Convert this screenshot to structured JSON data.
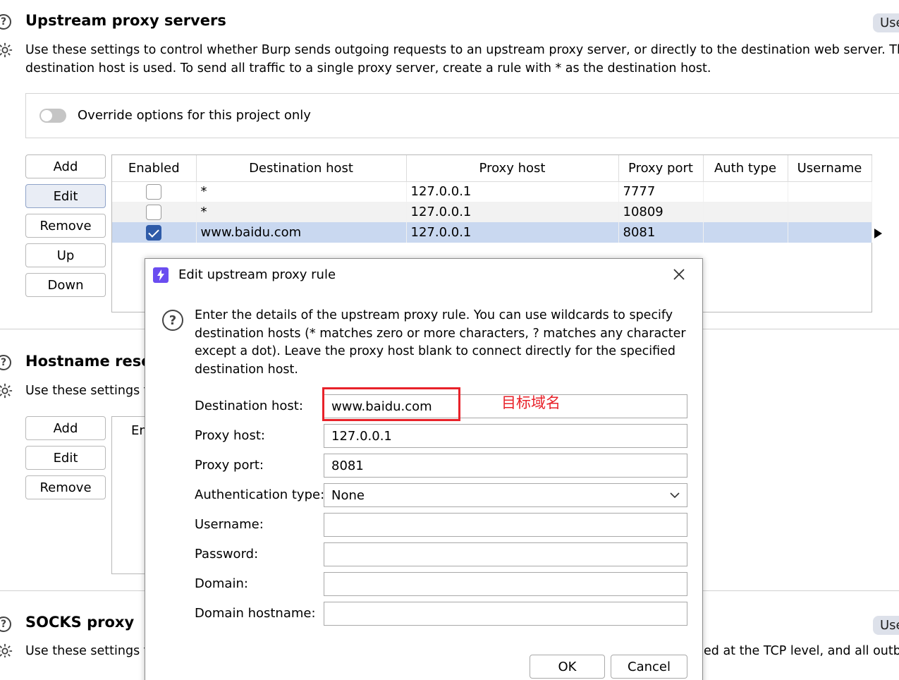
{
  "upstream": {
    "title": "Upstream proxy servers",
    "use_label": "Use",
    "desc_line1": "Use these settings to  control whether Burp sends outgoing requests to an upstream proxy server, or directly to the destination web server. The fi",
    "desc_line2": "destination host is used. To send all traffic to a single proxy server, create a rule with * as the destination host.",
    "override_label": "Override options for this project only",
    "buttons": {
      "add": "Add",
      "edit": "Edit",
      "remove": "Remove",
      "up": "Up",
      "down": "Down"
    },
    "table": {
      "headers": [
        "Enabled",
        "Destination host",
        "Proxy host",
        "Proxy port",
        "Auth type",
        "Username"
      ],
      "rows": [
        {
          "enabled": false,
          "dest": "*",
          "proxy_host": "127.0.0.1",
          "proxy_port": "7777",
          "auth": "",
          "user": ""
        },
        {
          "enabled": false,
          "dest": "*",
          "proxy_host": "127.0.0.1",
          "proxy_port": "10809",
          "auth": "",
          "user": ""
        },
        {
          "enabled": true,
          "dest": "www.baidu.com",
          "proxy_host": "127.0.0.1",
          "proxy_port": "8081",
          "auth": "",
          "user": ""
        }
      ]
    }
  },
  "hostname": {
    "title": "Hostname resol",
    "desc": "Use these settings t",
    "buttons": {
      "add": "Add",
      "edit": "Edit",
      "remove": "Remove"
    },
    "col_header": "En"
  },
  "socks": {
    "title": "SOCKS proxy",
    "use_label": "Use",
    "desc_left": "Use these settings t",
    "desc_right": "ed at the TCP level, and all outbo"
  },
  "dialog": {
    "title": "Edit upstream proxy rule",
    "help_text": [
      "Enter the details of the upstream proxy rule. You can use wildcards to specify",
      "destination hosts (* matches zero or more characters, ? matches any character",
      "except a dot). Leave the proxy host blank to connect directly for the specified",
      "destination host."
    ],
    "fields": {
      "dest_host_label": "Destination host:",
      "dest_host_value": "www.baidu.com",
      "proxy_host_label": "Proxy host:",
      "proxy_host_value": "127.0.0.1",
      "proxy_port_label": "Proxy port:",
      "proxy_port_value": "8081",
      "auth_type_label": "Authentication type:",
      "auth_type_value": "None",
      "username_label": "Username:",
      "username_value": "",
      "password_label": "Password:",
      "password_value": "",
      "domain_label": "Domain:",
      "domain_value": "",
      "domain_hostname_label": "Domain hostname:",
      "domain_hostname_value": ""
    },
    "annotation": "目标域名",
    "ok_label": "OK",
    "cancel_label": "Cancel"
  },
  "colors": {
    "selected_row": "#c9d8f0",
    "alt_row": "#f2f2f2",
    "highlight_box": "#e8222a",
    "dialog_icon": "#6a4df0"
  }
}
